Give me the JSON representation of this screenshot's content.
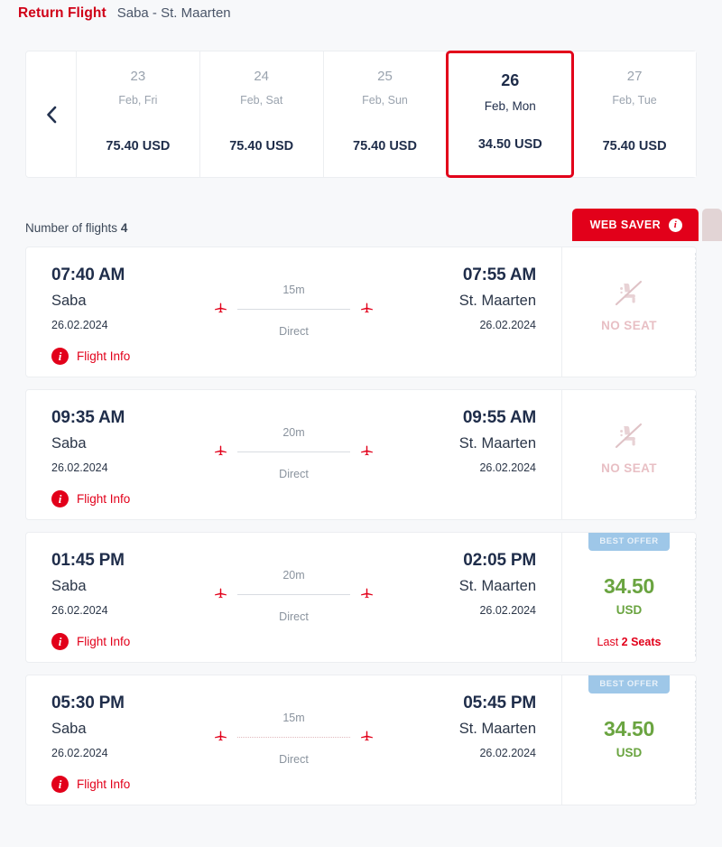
{
  "header": {
    "title": "Return Flight",
    "route": "Saba - St. Maarten"
  },
  "date_strip": {
    "prev_icon": "chevron-left-icon",
    "dates": [
      {
        "day": "23",
        "month_weekday": "Feb, Fri",
        "price": "75.40 USD",
        "selected": false
      },
      {
        "day": "24",
        "month_weekday": "Feb, Sat",
        "price": "75.40 USD",
        "selected": false
      },
      {
        "day": "25",
        "month_weekday": "Feb, Sun",
        "price": "75.40 USD",
        "selected": false
      },
      {
        "day": "26",
        "month_weekday": "Feb, Mon",
        "price": "34.50 USD",
        "selected": true
      },
      {
        "day": "27",
        "month_weekday": "Feb, Tue",
        "price": "75.40 USD",
        "selected": false
      }
    ]
  },
  "results": {
    "count_label": "Number of flights",
    "count_value": "4",
    "fare_tabs": [
      {
        "label": "WEB SAVER",
        "info_icon": "info-icon",
        "active": true
      },
      {
        "label": "",
        "active": false
      }
    ]
  },
  "flights": [
    {
      "departure": {
        "time": "07:40 AM",
        "city": "Saba",
        "date": "26.02.2024"
      },
      "arrival": {
        "time": "07:55 AM",
        "city": "St. Maarten",
        "date": "26.02.2024"
      },
      "duration": "15m",
      "stops": "Direct",
      "flight_info_label": "Flight Info",
      "fare": {
        "status": "no-seat",
        "no_seat_label": "NO SEAT"
      }
    },
    {
      "departure": {
        "time": "09:35 AM",
        "city": "Saba",
        "date": "26.02.2024"
      },
      "arrival": {
        "time": "09:55 AM",
        "city": "St. Maarten",
        "date": "26.02.2024"
      },
      "duration": "20m",
      "stops": "Direct",
      "flight_info_label": "Flight Info",
      "fare": {
        "status": "no-seat",
        "no_seat_label": "NO SEAT"
      }
    },
    {
      "departure": {
        "time": "01:45 PM",
        "city": "Saba",
        "date": "26.02.2024"
      },
      "arrival": {
        "time": "02:05 PM",
        "city": "St. Maarten",
        "date": "26.02.2024"
      },
      "duration": "20m",
      "stops": "Direct",
      "flight_info_label": "Flight Info",
      "fare": {
        "status": "available",
        "badge": "BEST OFFER",
        "amount": "34.50",
        "currency": "USD",
        "seats_prefix": "Last ",
        "seats_value": "2 Seats"
      }
    },
    {
      "departure": {
        "time": "05:30 PM",
        "city": "Saba",
        "date": "26.02.2024"
      },
      "arrival": {
        "time": "05:45 PM",
        "city": "St. Maarten",
        "date": "26.02.2024"
      },
      "duration": "15m",
      "stops": "Direct",
      "flight_info_label": "Flight Info",
      "fare": {
        "status": "available",
        "badge": "BEST OFFER",
        "amount": "34.50",
        "currency": "USD"
      }
    }
  ],
  "colors": {
    "brand_red": "#e2001a",
    "title_red": "#d00017",
    "navy": "#1f2d4a",
    "price_green": "#6aa440",
    "badge_blue": "#9ec7e8",
    "no_seat_pink": "#e8bfc4",
    "page_bg": "#f7f8fa"
  }
}
